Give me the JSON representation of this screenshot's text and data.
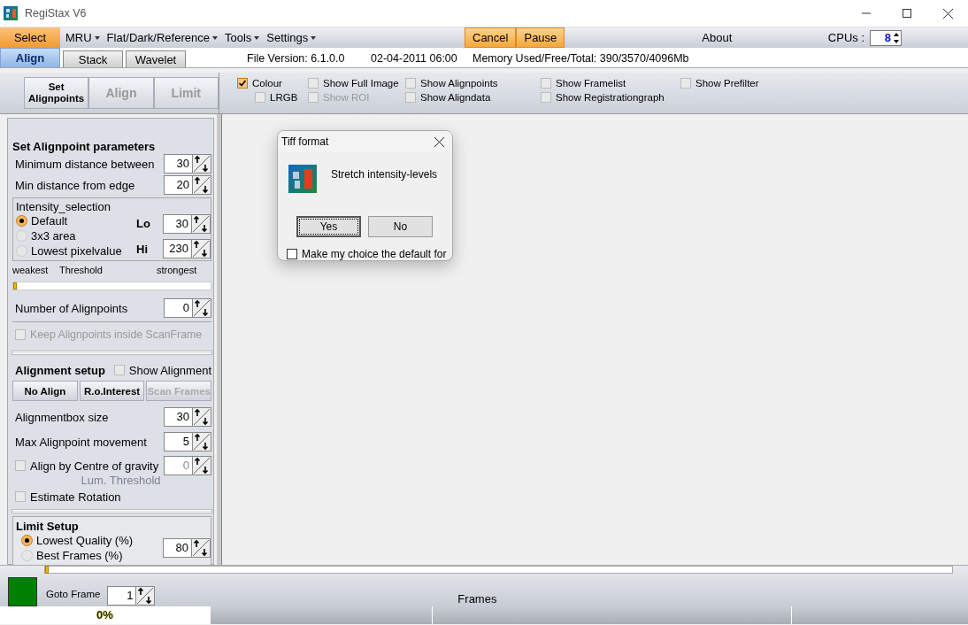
{
  "window": {
    "title": "RegiStax V6"
  },
  "menu": [
    {
      "label": "Select",
      "selected": true,
      "dropdown": false
    },
    {
      "label": "MRU",
      "selected": false,
      "dropdown": true
    },
    {
      "label": "Flat/Dark/Reference",
      "selected": false,
      "dropdown": true
    },
    {
      "label": "Tools",
      "selected": false,
      "dropdown": true
    },
    {
      "label": "Settings",
      "selected": false,
      "dropdown": true
    }
  ],
  "actions": [
    {
      "label": "Cancel",
      "highlighted": true
    },
    {
      "label": "Pause",
      "highlighted": true
    }
  ],
  "about": "About",
  "cpus": {
    "label": "CPUs :",
    "value": "8"
  },
  "tabs": [
    {
      "label": "Align",
      "selected": true
    },
    {
      "label": "Stack",
      "selected": false
    },
    {
      "label": "Wavelet",
      "selected": false
    }
  ],
  "info": [
    "File Version: 6.1.0.0",
    "02-04-2011 06:00",
    "Memory Used/Free/Total: 390/3570/4096Mb"
  ],
  "toolbar_buttons": [
    {
      "label": "Set Alignpoints",
      "disabled": false
    },
    {
      "label": "Align",
      "disabled": true
    },
    {
      "label": "Limit",
      "disabled": true
    }
  ],
  "view_options_top": [
    {
      "label": "Colour",
      "checked": true,
      "disabled": false
    },
    {
      "label": "Show Full Image",
      "checked": false,
      "disabled": false
    },
    {
      "label": "Show Alignpoints",
      "checked": false,
      "disabled": false
    },
    {
      "label": "Show Framelist",
      "checked": false,
      "disabled": false
    },
    {
      "label": "Show Prefilter",
      "checked": false,
      "disabled": false
    }
  ],
  "view_options_bottom": [
    {
      "label": "LRGB",
      "checked": false,
      "disabled": false
    },
    {
      "label": "Show ROI",
      "checked": false,
      "disabled": true
    },
    {
      "label": "Show Aligndata",
      "checked": false,
      "disabled": false
    },
    {
      "label": "Show Registrationgraph",
      "checked": false,
      "disabled": false
    }
  ],
  "alignpoint_parameters": {
    "title": "Set Alignpoint parameters",
    "fields": [
      {
        "label": "Minimum distance between",
        "value": "30"
      },
      {
        "label": "Min distance from edge",
        "value": "20"
      }
    ],
    "intensity_selection": {
      "title": "Intensity_selection",
      "options": [
        {
          "label": "Default",
          "selected": true
        },
        {
          "label": "3x3 area",
          "selected": false
        },
        {
          "label": "Lowest pixelvalue",
          "selected": false
        }
      ],
      "lo": {
        "label": "Lo",
        "value": "30"
      },
      "hi": {
        "label": "Hi",
        "value": "230"
      }
    },
    "threshold": {
      "labels": [
        "weakest",
        "Threshold",
        "strongest"
      ],
      "level": 0
    },
    "count": {
      "label": "Number of Alignpoints",
      "value": "0"
    },
    "keep_inside": {
      "label": "Keep Alignpoints inside ScanFrame",
      "checked": false,
      "disabled": true
    }
  },
  "alignment_setup": {
    "title": "Alignment setup",
    "show_alignment": {
      "label": "Show Alignment",
      "checked": false
    },
    "buttons": [
      {
        "label": "No Align",
        "disabled": false
      },
      {
        "label": "R.o.Interest",
        "disabled": false
      },
      {
        "label": "Scan Frames",
        "disabled": true
      }
    ],
    "fields": [
      {
        "label": "Alignmentbox size",
        "value": "30"
      },
      {
        "label": "Max Alignpoint movement",
        "value": "5"
      }
    ],
    "centre_of_gravity": {
      "label": "Align by Centre of gravity",
      "checked": false,
      "value": "0",
      "sublabel": "Lum. Threshold"
    },
    "estimate_rotation": {
      "label": "Estimate Rotation",
      "checked": false
    }
  },
  "limit_setup": {
    "title": "Limit Setup",
    "options": [
      {
        "label": "Lowest Quality (%)",
        "selected": true
      },
      {
        "label": "Best Frames (%)",
        "selected": false
      }
    ],
    "value": "80"
  },
  "dialog": {
    "title": "Tiff format",
    "message": "Stretch intensity-levels",
    "buttons": [
      {
        "label": "Yes",
        "selected": true
      },
      {
        "label": "No",
        "selected": false
      }
    ],
    "checkbox": {
      "label": "Make my choice the default for",
      "checked": false
    }
  },
  "frames": {
    "level": 0,
    "goto_label": "Goto Frame",
    "goto_value": "1",
    "label": "Frames"
  },
  "status_bar": {
    "progress": "0%"
  }
}
